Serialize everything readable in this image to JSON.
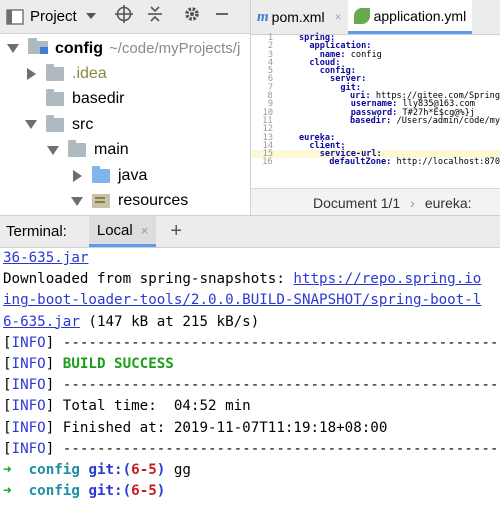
{
  "project_panel": {
    "title": "Project",
    "header_icons": [
      "dropdown-icon",
      "crosshair-icon",
      "collapse-icon",
      "gear-icon",
      "minimize-icon"
    ],
    "tree": [
      {
        "indent": 0,
        "expanded": true,
        "name": "config",
        "path": "~/code/myProjects/j",
        "icon": "module"
      },
      {
        "indent": 1,
        "expanded": false,
        "name": ".idea",
        "icon": "folder"
      },
      {
        "indent": 1,
        "expanded": null,
        "name": "basedir",
        "icon": "folder"
      },
      {
        "indent": 1,
        "expanded": true,
        "name": "src",
        "icon": "folder"
      },
      {
        "indent": 2,
        "expanded": true,
        "name": "main",
        "icon": "folder"
      },
      {
        "indent": 3,
        "expanded": false,
        "name": "java",
        "icon": "folder-blue"
      },
      {
        "indent": 3,
        "expanded": true,
        "name": "resources",
        "icon": "resources-folder"
      }
    ]
  },
  "editor": {
    "tabs": [
      {
        "label": "pom.xml",
        "icon": "maven-icon",
        "active": false
      },
      {
        "label": "application.yml",
        "icon": "spring-leaf-icon",
        "active": true
      }
    ],
    "lines": [
      {
        "n": "1",
        "indent": "",
        "key": "spring:",
        "val": ""
      },
      {
        "n": "2",
        "indent": "  ",
        "key": "application:",
        "val": ""
      },
      {
        "n": "3",
        "indent": "    ",
        "key": "name:",
        "val": " config"
      },
      {
        "n": "4",
        "indent": "  ",
        "key": "cloud:",
        "val": ""
      },
      {
        "n": "5",
        "indent": "    ",
        "key": "config:",
        "val": ""
      },
      {
        "n": "6",
        "indent": "      ",
        "key": "server:",
        "val": ""
      },
      {
        "n": "7",
        "indent": "        ",
        "key": "git:",
        "val": ""
      },
      {
        "n": "8",
        "indent": "          ",
        "key": "uri:",
        "val": " https://gitee.com/Spring"
      },
      {
        "n": "9",
        "indent": "          ",
        "key": "username:",
        "val": " lly835@163.com"
      },
      {
        "n": "10",
        "indent": "          ",
        "key": "password:",
        "val": " T#27h*E$cg@%}j"
      },
      {
        "n": "11",
        "indent": "          ",
        "key": "basedir:",
        "val": " /Users/admin/code/my"
      },
      {
        "n": "12",
        "indent": "",
        "key": "",
        "val": ""
      },
      {
        "n": "13",
        "indent": "",
        "key": "eureka:",
        "val": ""
      },
      {
        "n": "14",
        "indent": "  ",
        "key": "client:",
        "val": ""
      },
      {
        "n": "15",
        "indent": "    ",
        "key": "service-url:",
        "val": ""
      },
      {
        "n": "16",
        "indent": "      ",
        "key": "defaultZone:",
        "val": " http://localhost:870"
      }
    ],
    "highlight_line": "15",
    "status": {
      "document": "Document 1/1",
      "path": "eureka:"
    }
  },
  "terminal_bar": {
    "label": "Terminal:",
    "tab": "Local",
    "close": "×",
    "add": "+"
  },
  "terminal": {
    "line1_link": "36-635.jar",
    "line2_prefix": "Downloaded from spring-snapshots: ",
    "line2_link": "https://repo.spring.io",
    "line3_link": "ing-boot-loader-tools/2.0.0.BUILD-SNAPSHOT/spring-boot-l",
    "line4_link": "6-635.jar",
    "line4_rest": " (147 kB at 215 kB/s)",
    "info_open": "[",
    "info_word": "INFO",
    "info_close": "]",
    "dash_line": " ---------------------------------------------------------",
    "build_success": " BUILD SUCCESS",
    "total_time": " Total time:  04:52 min",
    "finished_at": " Finished at: 2019-11-07T11:19:18+08:00",
    "prompt_arrow": "➜",
    "prompt_dir": "config",
    "prompt_git": "git:(",
    "prompt_branch": "6-5",
    "prompt_git_close": ")",
    "cmd1": " gg",
    "cmd2": ""
  }
}
